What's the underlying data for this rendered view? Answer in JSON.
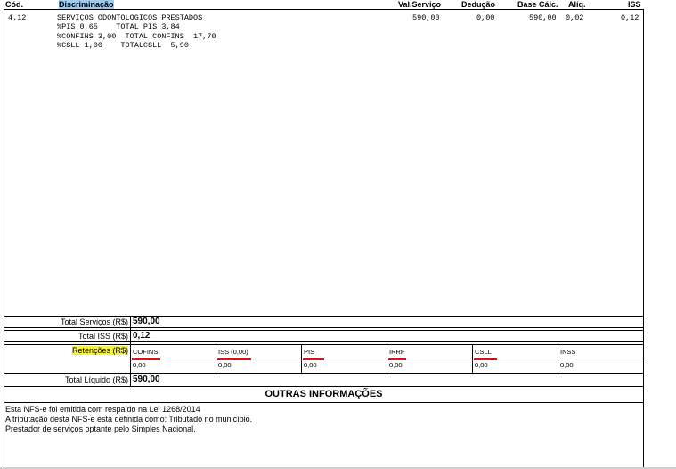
{
  "header": {
    "cod": "Cód.",
    "discriminacao": "Discriminação",
    "val_servico": "Val.Serviço",
    "deducao": "Dedução",
    "base_calc": "Base Cálc.",
    "aliq": "Alíq.",
    "iss": "ISS"
  },
  "service": {
    "cod": "4.12",
    "lines": [
      "SERVIÇOS ODONTOLOGICOS PRESTADOS",
      "%PIS 0,65    TOTAL PIS 3,84",
      "%CONFINS 3,00  TOTAL CONFINS  17,70",
      "%CSLL 1,00    TOTALCSLL  5,90"
    ],
    "val_servico": "590,00",
    "deducao": "0,00",
    "base_calc": "590,00",
    "aliq": "0,02",
    "iss": "0,12"
  },
  "totals": {
    "total_servicos_label": "Total Serviços (R$)",
    "total_servicos_value": "590,00",
    "total_iss_label": "Total ISS (R$)",
    "total_iss_value": "0,12",
    "retencoes_label": "Retenções (R$)",
    "total_liquido_label": "Total Líquido (R$)",
    "total_liquido_value": "590,00"
  },
  "retencoes": [
    {
      "name": "COFINS",
      "value": "0,00"
    },
    {
      "name": "ISS (0,00)",
      "value": "0,00"
    },
    {
      "name": "PIS",
      "value": "0,00"
    },
    {
      "name": "IRRF",
      "value": "0,00"
    },
    {
      "name": "CSLL",
      "value": "0,00"
    },
    {
      "name": "INSS",
      "value": "0,00"
    }
  ],
  "outras": {
    "title": "OUTRAS INFORMAÇÕES",
    "lines": [
      "Esta NFS-e foi emitida com respaldo na Lei 1268/2014",
      "A tributação desta NFS-e está definida como: Tributado no município.",
      "Prestador de serviços optante pelo Simples Nacional."
    ]
  },
  "colors": {
    "highlight_yellow": "#f7f24a",
    "highlight_blue": "#9ecbf0",
    "underline_red": "#d11111"
  }
}
